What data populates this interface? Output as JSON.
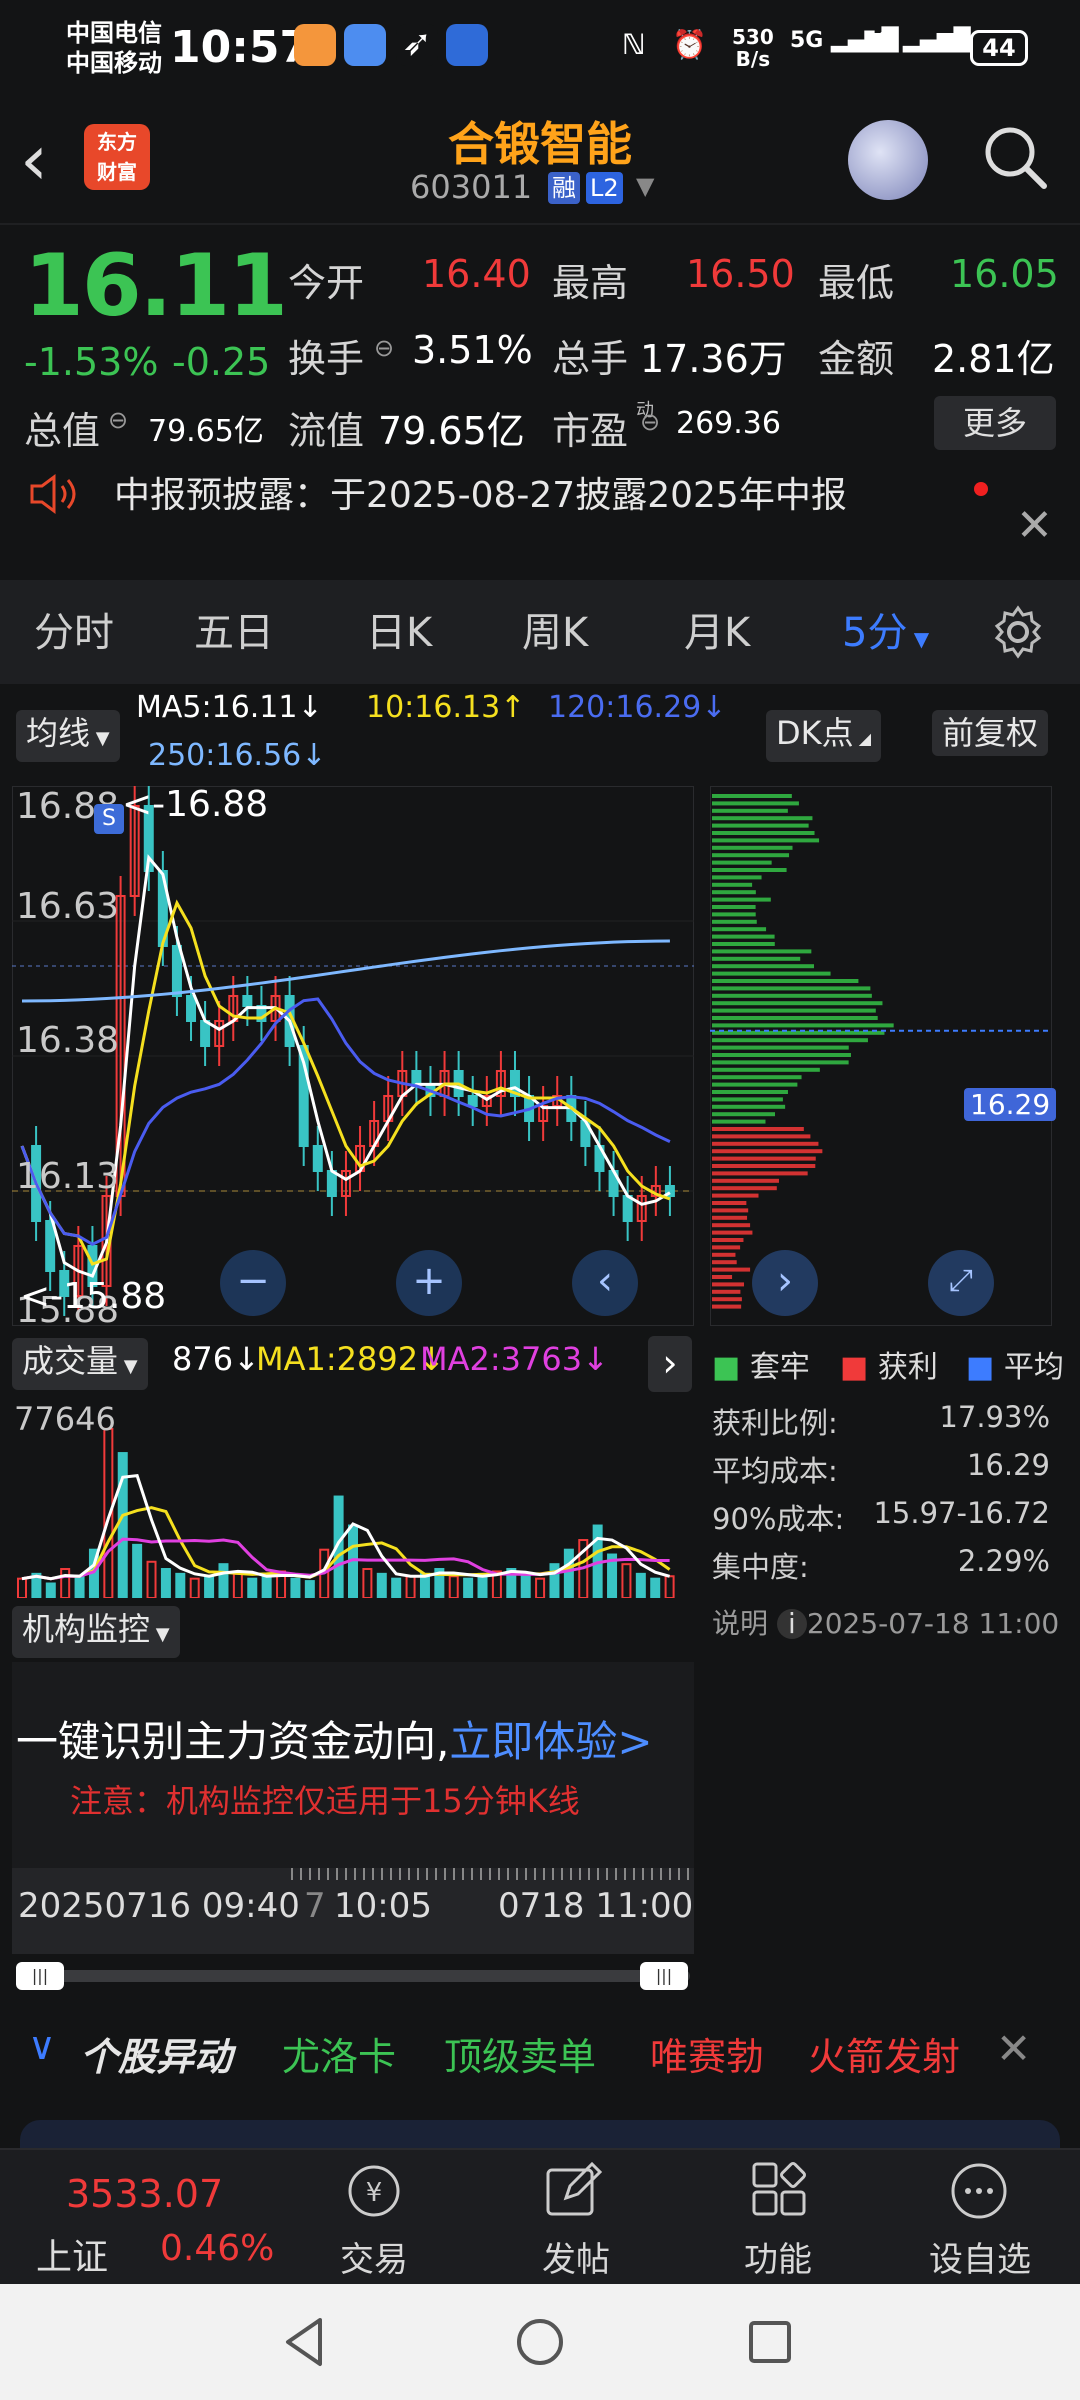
{
  "status": {
    "carrier1": "中国电信",
    "carrier2": "中国移动",
    "time": "10:57",
    "netspeed": "530",
    "netunit": "B/s",
    "sig1": "5G",
    "sig2": "5G",
    "battery": "44"
  },
  "header": {
    "title": "合锻智能",
    "code": "603011",
    "tag_margin": "融",
    "tag_level": "L2"
  },
  "quote": {
    "price": "16.11",
    "change_pct": "-1.53%",
    "change_abs": "-0.25",
    "open_label": "今开",
    "open": "16.40",
    "high_label": "最高",
    "high": "16.50",
    "low_label": "最低",
    "low": "16.05",
    "turnover_label": "换手",
    "turnover": "3.51%",
    "volume_label": "总手",
    "volume": "17.36万",
    "amount_label": "金额",
    "amount": "2.81亿",
    "mktcap_label": "总值",
    "mktcap": "79.65亿",
    "float_label": "流值",
    "float": "79.65亿",
    "pe_label": "市盈",
    "pe_sup": "动",
    "pe": "269.36",
    "more": "更多"
  },
  "notice": {
    "text": "中报预披露：于2025-08-27披露2025年中报"
  },
  "tabs": [
    "分时",
    "五日",
    "日K",
    "周K",
    "月K",
    "5分"
  ],
  "chart": {
    "ma_label": "均线",
    "ma5": "MA5:16.11↓",
    "ma10": "10:16.13↑",
    "ma120": "120:16.29↓",
    "ma250": "250:16.56↓",
    "dk": "DK点",
    "adj": "前复权",
    "ticks": [
      "16.88",
      "16.63",
      "16.38",
      "16.13",
      "15.88"
    ],
    "max_note": "<-16.88",
    "min_note": "<-15.88",
    "s_mark": "S",
    "chip_avg": "16.29",
    "vol_label": "成交量",
    "vol_now": "876↓",
    "ma1": "MA1:2892↓",
    "ma2": "MA2:3763↓",
    "vol_max": "77646",
    "inst_label": "机构监控",
    "inst_promo": "一键识别主力资金动向,",
    "inst_cta": "立即体验>",
    "inst_note": "注意：机构监控仅适用于15分钟K线",
    "time_start": "20250716 09:40",
    "time_mid_a": "7",
    "time_mid_b": "10:05",
    "time_end": "0718 11:00"
  },
  "chips": {
    "legend": [
      "套牢",
      "获利",
      "平均"
    ],
    "stats": [
      [
        "获利比例:",
        "17.93%"
      ],
      [
        "平均成本:",
        "16.29"
      ],
      [
        "90%成本:",
        "15.97-16.72"
      ],
      [
        "集中度:",
        "2.29%"
      ]
    ],
    "note_label": "说明",
    "note_date": "2025-07-18 11:00"
  },
  "movers": {
    "label": "个股异动",
    "items": [
      "尤洛卡",
      "顶级卖单",
      "唯赛勃",
      "火箭发射"
    ]
  },
  "bottom": {
    "index_value": "3533.07",
    "index_name": "上证",
    "index_pct": "0.46%",
    "items": [
      "交易",
      "发帖",
      "功能",
      "设自选"
    ]
  },
  "chart_data": {
    "type": "candlestick",
    "period": "5分",
    "price_range": [
      15.88,
      16.88
    ],
    "volume_max": 77646
  }
}
